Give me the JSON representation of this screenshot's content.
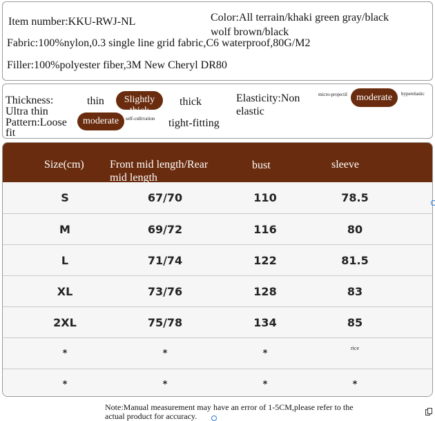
{
  "info": {
    "item_number": "Item number:KKU-RWJ-NL",
    "color_line1": "Color:All terrain/khaki green gray/black",
    "color_line2": "wolf brown/black",
    "fabric": "Fabric:100%nylon,0.3 single line grid fabric,C6 waterproof,80G/M2",
    "filler": "Filler:100%polyester fiber,3M New Cheryl DR80"
  },
  "attributes": {
    "thickness_label": "Thickness:",
    "thickness_ultra": "Ultra thin",
    "thickness_thin": "thin",
    "thickness_selected_l1": "Slightly",
    "thickness_selected_l2": "thick",
    "thickness_thick": "thick",
    "elasticity_label": "Elasticity:Non",
    "elasticity_label2": "elastic",
    "elasticity_micro": "micro-projectil",
    "elasticity_selected": "moderate",
    "elasticity_hyper": "hyperelastic",
    "pattern_label": "Pattern:Loose",
    "pattern_label2": "fit",
    "pattern_selected": "moderate",
    "pattern_self": "self-cultivation",
    "pattern_tight": "tight-fitting",
    "selected_color": "#6a2c0e"
  },
  "table": {
    "headers": [
      "Size(cm)",
      "Front mid length/Rear",
      "mid length",
      "bust",
      "sleeve"
    ],
    "rows": [
      [
        "S",
        "67/70",
        "110",
        "78.5"
      ],
      [
        "M",
        "69/72",
        "116",
        "80"
      ],
      [
        "L",
        "71/74",
        "122",
        "81.5"
      ],
      [
        "XL",
        "73/76",
        "128",
        "83"
      ],
      [
        "2XL",
        "75/78",
        "134",
        "85"
      ],
      [
        "*",
        "*",
        "*",
        "rice"
      ],
      [
        "*",
        "*",
        "*",
        "*"
      ]
    ],
    "header_color": "#6a2c0e"
  },
  "note": {
    "line1": "Note:Manual measurement may have an error of 1-5CM,please refer to the",
    "line2": "actual product for accuracy."
  }
}
